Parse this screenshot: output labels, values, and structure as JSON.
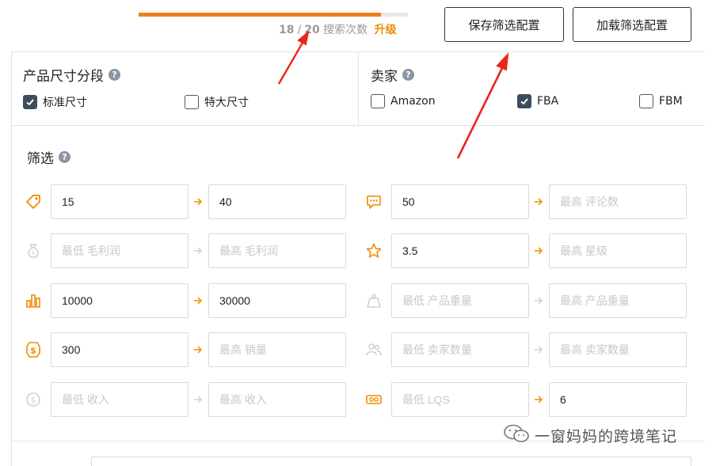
{
  "top": {
    "progress_fraction": 0.9,
    "searches_used": "18",
    "separator": "/",
    "searches_total": "20",
    "searches_label": "搜索次数",
    "upgrade_label": "升级",
    "save_button": "保存筛选配置",
    "load_button": "加载筛选配置"
  },
  "size_tier": {
    "title": "产品尺寸分段",
    "options": [
      {
        "label": "标准尺寸",
        "checked": true
      },
      {
        "label": "特大尺寸",
        "checked": false
      }
    ]
  },
  "seller": {
    "title": "卖家",
    "options": [
      {
        "label": "Amazon",
        "checked": false
      },
      {
        "label": "FBA",
        "checked": true
      },
      {
        "label": "FBM",
        "checked": false
      }
    ]
  },
  "filters": {
    "title": "筛选",
    "rows": [
      {
        "icon": "price-tag-icon",
        "min": {
          "value": "15",
          "placeholder": ""
        },
        "max": {
          "value": "40",
          "placeholder": ""
        }
      },
      {
        "icon": "money-bag-icon",
        "min": {
          "value": "",
          "placeholder": "最低 毛利润"
        },
        "max": {
          "value": "",
          "placeholder": "最高 毛利润"
        }
      },
      {
        "icon": "bar-chart-icon",
        "min": {
          "value": "10000",
          "placeholder": ""
        },
        "max": {
          "value": "30000",
          "placeholder": ""
        }
      },
      {
        "icon": "dollar-badge-icon",
        "min": {
          "value": "300",
          "placeholder": ""
        },
        "max": {
          "value": "",
          "placeholder": "最高 销量"
        }
      },
      {
        "icon": "dollar-coin-icon",
        "min": {
          "value": "",
          "placeholder": "最低 收入"
        },
        "max": {
          "value": "",
          "placeholder": "最高 收入"
        }
      }
    ],
    "rows_right": [
      {
        "icon": "comment-icon",
        "min": {
          "value": "50",
          "placeholder": ""
        },
        "max": {
          "value": "",
          "placeholder": "最高 评论数"
        }
      },
      {
        "icon": "star-icon",
        "min": {
          "value": "3.5",
          "placeholder": ""
        },
        "max": {
          "value": "",
          "placeholder": "最高 星级"
        }
      },
      {
        "icon": "weight-icon",
        "min": {
          "value": "",
          "placeholder": "最低 产品重量"
        },
        "max": {
          "value": "",
          "placeholder": "最高 产品重量"
        }
      },
      {
        "icon": "sellers-icon",
        "min": {
          "value": "",
          "placeholder": "最低 卖家数量"
        },
        "max": {
          "value": "",
          "placeholder": "最高 卖家数量"
        }
      },
      {
        "icon": "lqs-icon",
        "min": {
          "value": "",
          "placeholder": "最低 LQS"
        },
        "max": {
          "value": "6",
          "placeholder": ""
        }
      }
    ]
  },
  "watermark": {
    "text": "一窗妈妈的跨境笔记",
    "icon": "wechat-icon"
  },
  "colors": {
    "accent": "#ef7f1a",
    "annotation_arrow": "#e8261c",
    "checkbox_checked": "#3d4d5e"
  }
}
